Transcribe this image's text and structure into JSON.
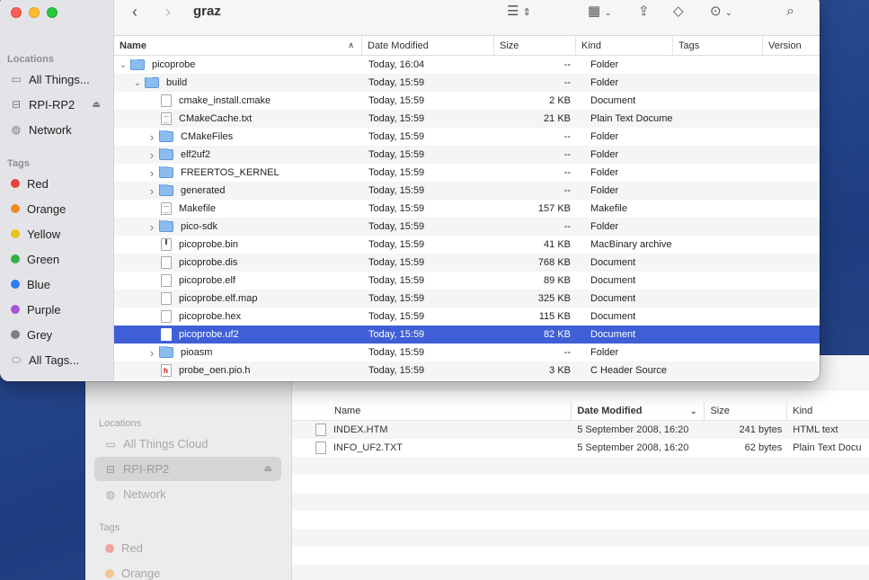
{
  "front": {
    "title": "graz",
    "sidebar": {
      "locations_label": "Locations",
      "locations": [
        {
          "label": "All Things...",
          "icon": "laptop-icon"
        },
        {
          "label": "RPI-RP2",
          "icon": "drive-icon",
          "ejectable": true
        },
        {
          "label": "Network",
          "icon": "globe-icon"
        }
      ],
      "tags_label": "Tags",
      "tags": [
        {
          "label": "Red",
          "color": "#e8413a"
        },
        {
          "label": "Orange",
          "color": "#f08a24"
        },
        {
          "label": "Yellow",
          "color": "#e8c31a"
        },
        {
          "label": "Green",
          "color": "#32b146"
        },
        {
          "label": "Blue",
          "color": "#2f7cf5"
        },
        {
          "label": "Purple",
          "color": "#a656d0"
        },
        {
          "label": "Grey",
          "color": "#7e7e83"
        }
      ],
      "all_tags_label": "All Tags..."
    },
    "columns": {
      "name": "Name",
      "date": "Date Modified",
      "size": "Size",
      "kind": "Kind",
      "tags": "Tags",
      "version": "Version"
    },
    "rows": [
      {
        "name": "picoprobe",
        "date": "Today, 16:04",
        "size": "--",
        "kind": "Folder",
        "type": "folder",
        "disclosure": "open",
        "depth": 0
      },
      {
        "name": "build",
        "date": "Today, 15:59",
        "size": "--",
        "kind": "Folder",
        "type": "folder",
        "disclosure": "open",
        "depth": 1
      },
      {
        "name": "cmake_install.cmake",
        "date": "Today, 15:59",
        "size": "2 KB",
        "kind": "Document",
        "type": "file",
        "depth": 2
      },
      {
        "name": "CMakeCache.txt",
        "date": "Today, 15:59",
        "size": "21 KB",
        "kind": "Plain Text Document",
        "type": "txt",
        "depth": 2
      },
      {
        "name": "CMakeFiles",
        "date": "Today, 15:59",
        "size": "--",
        "kind": "Folder",
        "type": "folder",
        "disclosure": "closed",
        "depth": 2
      },
      {
        "name": "elf2uf2",
        "date": "Today, 15:59",
        "size": "--",
        "kind": "Folder",
        "type": "folder",
        "disclosure": "closed",
        "depth": 2
      },
      {
        "name": "FREERTOS_KERNEL",
        "date": "Today, 15:59",
        "size": "--",
        "kind": "Folder",
        "type": "folder",
        "disclosure": "closed",
        "depth": 2
      },
      {
        "name": "generated",
        "date": "Today, 15:59",
        "size": "--",
        "kind": "Folder",
        "type": "folder",
        "disclosure": "closed",
        "depth": 2
      },
      {
        "name": "Makefile",
        "date": "Today, 15:59",
        "size": "157 KB",
        "kind": "Makefile",
        "type": "txt",
        "depth": 2
      },
      {
        "name": "pico-sdk",
        "date": "Today, 15:59",
        "size": "--",
        "kind": "Folder",
        "type": "folder",
        "disclosure": "closed",
        "depth": 2
      },
      {
        "name": "picoprobe.bin",
        "date": "Today, 15:59",
        "size": "41 KB",
        "kind": "MacBinary archive",
        "type": "bin",
        "depth": 2
      },
      {
        "name": "picoprobe.dis",
        "date": "Today, 15:59",
        "size": "768 KB",
        "kind": "Document",
        "type": "file",
        "depth": 2
      },
      {
        "name": "picoprobe.elf",
        "date": "Today, 15:59",
        "size": "89 KB",
        "kind": "Document",
        "type": "file",
        "depth": 2
      },
      {
        "name": "picoprobe.elf.map",
        "date": "Today, 15:59",
        "size": "325 KB",
        "kind": "Document",
        "type": "file",
        "depth": 2
      },
      {
        "name": "picoprobe.hex",
        "date": "Today, 15:59",
        "size": "115 KB",
        "kind": "Document",
        "type": "file",
        "depth": 2
      },
      {
        "name": "picoprobe.uf2",
        "date": "Today, 15:59",
        "size": "82 KB",
        "kind": "Document",
        "type": "file",
        "depth": 2,
        "selected": true
      },
      {
        "name": "pioasm",
        "date": "Today, 15:59",
        "size": "--",
        "kind": "Folder",
        "type": "folder",
        "disclosure": "closed",
        "depth": 2
      },
      {
        "name": "probe_oen.pio.h",
        "date": "Today, 15:59",
        "size": "3 KB",
        "kind": "C Header Source",
        "type": "hdr",
        "depth": 2
      }
    ]
  },
  "back": {
    "sidebar": {
      "locations_label": "Locations",
      "locations": [
        {
          "label": "All Things Cloud",
          "icon": "laptop-icon"
        },
        {
          "label": "RPI-RP2",
          "icon": "drive-icon",
          "selected": true,
          "ejectable": true
        },
        {
          "label": "Network",
          "icon": "globe-icon"
        }
      ],
      "tags_label": "Tags",
      "tags": [
        {
          "label": "Red",
          "color": "#f2a3a0"
        },
        {
          "label": "Orange",
          "color": "#f3c690"
        }
      ]
    },
    "columns": {
      "name": "Name",
      "date": "Date Modified",
      "size": "Size",
      "kind": "Kind"
    },
    "rows": [
      {
        "name": "INDEX.HTM",
        "date": "5 September 2008, 16:20",
        "size": "241 bytes",
        "kind": "HTML text"
      },
      {
        "name": "INFO_UF2.TXT",
        "date": "5 September 2008, 16:20",
        "size": "62 bytes",
        "kind": "Plain Text Docu"
      }
    ]
  }
}
